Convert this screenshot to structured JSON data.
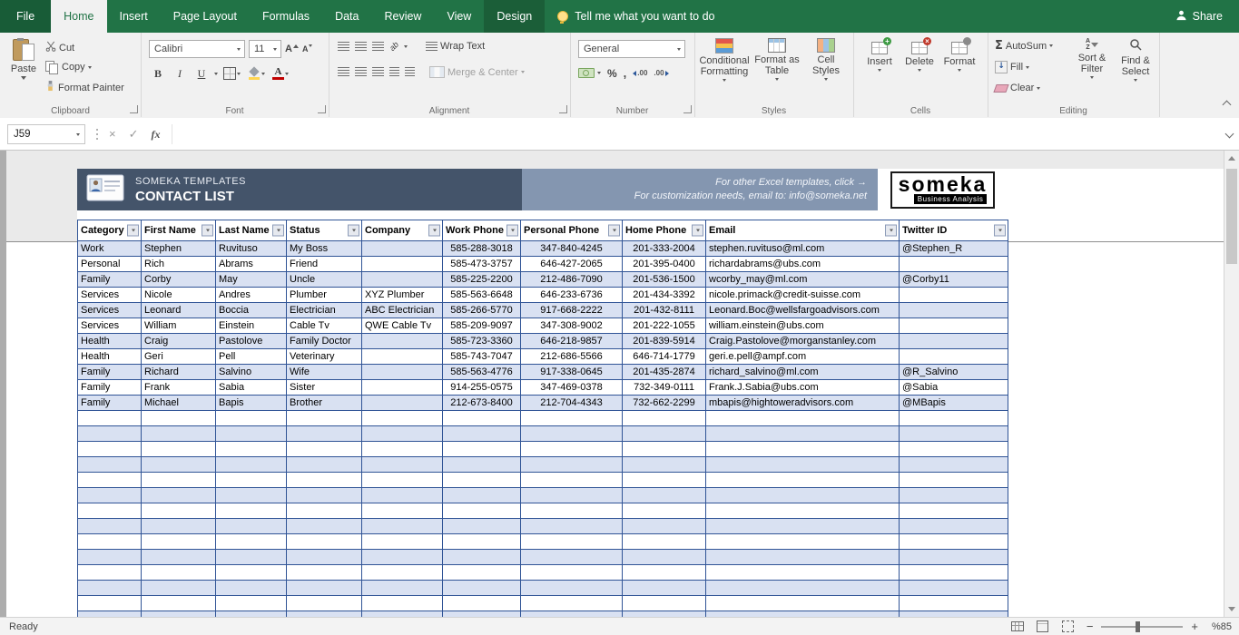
{
  "tabs": {
    "items": [
      {
        "label": "File"
      },
      {
        "label": "Home"
      },
      {
        "label": "Insert"
      },
      {
        "label": "Page Layout"
      },
      {
        "label": "Formulas"
      },
      {
        "label": "Data"
      },
      {
        "label": "Review"
      },
      {
        "label": "View"
      },
      {
        "label": "Design"
      }
    ],
    "tell_me": "Tell me what you want to do",
    "share": "Share"
  },
  "ribbon": {
    "clipboard": {
      "label": "Clipboard",
      "paste": "Paste",
      "cut": "Cut",
      "copy": "Copy",
      "format_painter": "Format Painter"
    },
    "font": {
      "label": "Font",
      "font_name": "Calibri",
      "font_size": "11"
    },
    "alignment": {
      "label": "Alignment",
      "wrap_text": "Wrap Text",
      "merge_center": "Merge & Center"
    },
    "number": {
      "label": "Number",
      "format": "General"
    },
    "styles": {
      "label": "Styles",
      "conditional": "Conditional Formatting",
      "format_table": "Format as Table",
      "cell_styles": "Cell Styles"
    },
    "cells": {
      "label": "Cells",
      "insert": "Insert",
      "delete": "Delete",
      "format": "Format"
    },
    "editing": {
      "label": "Editing",
      "autosum": "AutoSum",
      "fill": "Fill",
      "clear": "Clear",
      "sort_filter": "Sort & Filter",
      "find_select": "Find & Select"
    }
  },
  "formula_bar": {
    "name_box": "J59",
    "fx": "fx",
    "value": ""
  },
  "sheet": {
    "banner": {
      "brand": "SOMEKA TEMPLATES",
      "title": "CONTACT LIST",
      "promo_line1": "For other Excel templates, click →",
      "promo_line2": "For customization needs, email to: info@someka.net",
      "logo_text": "someka",
      "logo_sub": "Business Analysis"
    },
    "table": {
      "columns": [
        "Category",
        "First Name",
        "Last Name",
        "Status",
        "Company",
        "Work Phone",
        "Personal Phone",
        "Home Phone",
        "Email",
        "Twitter ID"
      ],
      "rows": [
        [
          "Work",
          "Stephen",
          "Ruvituso",
          "My Boss",
          "",
          "585-288-3018",
          "347-840-4245",
          "201-333-2004",
          "stephen.ruvituso@ml.com",
          "@Stephen_R"
        ],
        [
          "Personal",
          "Rich",
          "Abrams",
          "Friend",
          "",
          "585-473-3757",
          "646-427-2065",
          "201-395-0400",
          "richardabrams@ubs.com",
          ""
        ],
        [
          "Family",
          "Corby",
          "May",
          "Uncle",
          "",
          "585-225-2200",
          "212-486-7090",
          "201-536-1500",
          "wcorby_may@ml.com",
          "@Corby11"
        ],
        [
          "Services",
          "Nicole",
          "Andres",
          "Plumber",
          "XYZ Plumber",
          "585-563-6648",
          "646-233-6736",
          "201-434-3392",
          "nicole.primack@credit-suisse.com",
          ""
        ],
        [
          "Services",
          "Leonard",
          "Boccia",
          "Electrician",
          "ABC Electrician",
          "585-266-5770",
          "917-668-2222",
          "201-432-8111",
          "Leonard.Boc@wellsfargoadvisors.com",
          ""
        ],
        [
          "Services",
          "William",
          "Einstein",
          "Cable Tv",
          "QWE Cable Tv",
          "585-209-9097",
          "347-308-9002",
          "201-222-1055",
          "william.einstein@ubs.com",
          ""
        ],
        [
          "Health",
          "Craig",
          "Pastolove",
          "Family Doctor",
          "",
          "585-723-3360",
          "646-218-9857",
          "201-839-5914",
          "Craig.Pastolove@morganstanley.com",
          ""
        ],
        [
          "Health",
          "Geri",
          "Pell",
          "Veterinary",
          "",
          "585-743-7047",
          "212-686-5566",
          "646-714-1779",
          "geri.e.pell@ampf.com",
          ""
        ],
        [
          "Family",
          "Richard",
          "Salvino",
          "Wife",
          "",
          "585-563-4776",
          "917-338-0645",
          "201-435-2874",
          "richard_salvino@ml.com",
          "@R_Salvino"
        ],
        [
          "Family",
          "Frank",
          "Sabia",
          "Sister",
          "",
          "914-255-0575",
          "347-469-0378",
          "732-349-0111",
          "Frank.J.Sabia@ubs.com",
          "@Sabia"
        ],
        [
          "Family",
          "Michael",
          "Bapis",
          "Brother",
          "",
          "212-673-8400",
          "212-704-4343",
          "732-662-2299",
          "mbapis@hightoweradvisors.com",
          "@MBapis"
        ]
      ],
      "empty_rows": 14
    }
  },
  "status_bar": {
    "mode": "Ready",
    "zoom": "%85"
  },
  "colors": {
    "accent_green": "#217346",
    "tab_dark_green": "#185C37",
    "ribbon_bg": "#F1F1F1",
    "banner_dark": "#44546A",
    "banner_light": "#8496B0",
    "row_alt": "#D9E1F2",
    "table_border": "#305496",
    "status_bg": "#F3F3F3"
  }
}
